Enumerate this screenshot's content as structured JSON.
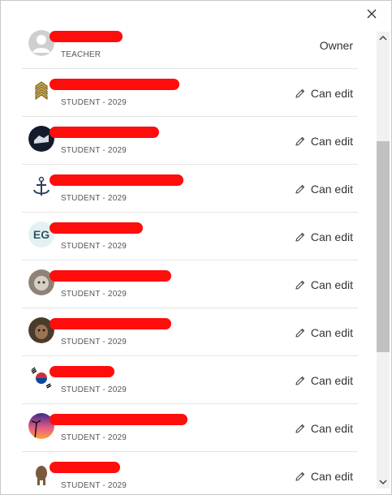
{
  "close_icon": "close-icon",
  "members": [
    {
      "name": "",
      "subtitle": "TEACHER",
      "role": "Owner",
      "editable": false,
      "avatar": "default"
    },
    {
      "name": "",
      "subtitle": "STUDENT - 2029",
      "role": "Can edit",
      "editable": true,
      "avatar": "chevron-rank"
    },
    {
      "name": "",
      "subtitle": "STUDENT - 2029",
      "role": "Can edit",
      "editable": true,
      "avatar": "dark-photo"
    },
    {
      "name": "",
      "subtitle": "STUDENT - 2029",
      "role": "Can edit",
      "editable": true,
      "avatar": "anchor"
    },
    {
      "name": "",
      "subtitle": "STUDENT - 2029",
      "role": "Can edit",
      "editable": true,
      "avatar": "initials",
      "initials": "EG"
    },
    {
      "name": "",
      "subtitle": "STUDENT - 2029",
      "role": "Can edit",
      "editable": true,
      "avatar": "cat-photo"
    },
    {
      "name": "",
      "subtitle": "STUDENT - 2029",
      "role": "Can edit",
      "editable": true,
      "avatar": "dog-photo"
    },
    {
      "name": "",
      "subtitle": "STUDENT - 2029",
      "role": "Can edit",
      "editable": true,
      "avatar": "korea-flag"
    },
    {
      "name": "",
      "subtitle": "STUDENT - 2029",
      "role": "Can edit",
      "editable": true,
      "avatar": "sunset-photo"
    },
    {
      "name": "",
      "subtitle": "STUDENT - 2029",
      "role": "Can edit",
      "editable": true,
      "avatar": "animal-photo"
    }
  ],
  "colors": {
    "redaction": "#ff0d0d",
    "initials_bg": "#e4f1f4",
    "divider": "#e4e4e4"
  }
}
